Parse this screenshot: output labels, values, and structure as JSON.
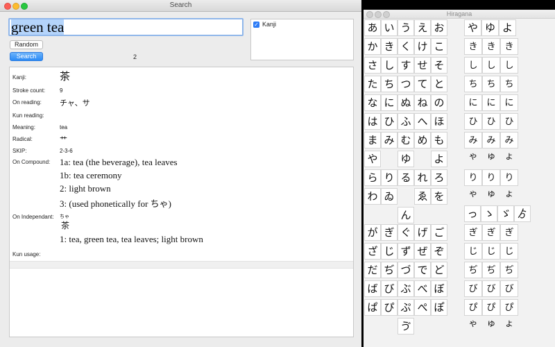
{
  "search_window": {
    "title": "Search",
    "query": "green tea",
    "random_label": "Random",
    "search_label": "Search",
    "result_count": "2",
    "kanji_filter_label": "Kanji",
    "kanji_filter_checked": true
  },
  "result": {
    "labels": {
      "kanji": "Kanji:",
      "stroke_count": "Stroke count:",
      "on_reading": "On reading:",
      "kun_reading": "Kun reading:",
      "meaning": "Meaning:",
      "radical": "Radical:",
      "skip": "SKIP:",
      "on_compound": "On Compound:",
      "on_independant": "On Independant:",
      "kun_usage": "Kun usage:"
    },
    "kanji": "茶",
    "stroke_count": "9",
    "on_reading": "チャ、サ",
    "kun_reading": "",
    "meaning": "tea",
    "radical": "艹",
    "skip": "2-3-6",
    "on_compound": [
      "1a: tea (the beverage), tea leaves",
      "1b: tea ceremony",
      "2: light brown",
      "3: (used phonetically for ちゃ)"
    ],
    "on_independant_ruby": "ちゃ",
    "on_independant_kanji": "茶",
    "on_independant_meaning": "1: tea, green tea, tea leaves; light brown"
  },
  "hiragana_window": {
    "title": "Hiragana",
    "basic_rows": [
      [
        "あ",
        "い",
        "う",
        "え",
        "お"
      ],
      [
        "か",
        "き",
        "く",
        "け",
        "こ"
      ],
      [
        "さ",
        "し",
        "す",
        "せ",
        "そ"
      ],
      [
        "た",
        "ち",
        "つ",
        "て",
        "と"
      ],
      [
        "な",
        "に",
        "ぬ",
        "ね",
        "の"
      ],
      [
        "は",
        "ひ",
        "ふ",
        "へ",
        "ほ"
      ],
      [
        "ま",
        "み",
        "む",
        "め",
        "も"
      ],
      [
        "や",
        "",
        "ゆ",
        "",
        "よ"
      ],
      [
        "ら",
        "り",
        "る",
        "れ",
        "ろ"
      ],
      [
        "わ",
        "ゐ",
        "",
        "ゑ",
        "を"
      ],
      [
        "",
        "",
        "ん",
        "",
        ""
      ]
    ],
    "combo_top": [
      [
        "や",
        "ゆ",
        "よ"
      ],
      [
        "きゃ",
        "きゅ",
        "きょ"
      ],
      [
        "しゃ",
        "しゅ",
        "しょ"
      ],
      [
        "ちゃ",
        "ちゅ",
        "ちょ"
      ],
      [
        "にゃ",
        "にゅ",
        "にょ"
      ],
      [
        "ひゃ",
        "ひゅ",
        "ひょ"
      ],
      [
        "みゃ",
        "みゅ",
        "みょ"
      ],
      [
        "",
        "",
        ""
      ],
      [
        "りゃ",
        "りゅ",
        "りょ"
      ]
    ],
    "marks": [
      "っ",
      "ゝ",
      "ゞ",
      "ゟ"
    ],
    "voiced_rows": [
      [
        "が",
        "ぎ",
        "ぐ",
        "げ",
        "ご"
      ],
      [
        "ざ",
        "じ",
        "ず",
        "ぜ",
        "ぞ"
      ],
      [
        "だ",
        "ぢ",
        "づ",
        "で",
        "ど"
      ],
      [
        "ば",
        "び",
        "ぶ",
        "べ",
        "ぼ"
      ],
      [
        "ぱ",
        "ぴ",
        "ぷ",
        "ぺ",
        "ぽ"
      ],
      [
        "",
        "",
        "ゔ",
        "",
        ""
      ]
    ],
    "voiced_combos": [
      [
        "ぎゃ",
        "ぎゅ",
        "ぎょ"
      ],
      [
        "じゃ",
        "じゅ",
        "じょ"
      ],
      [
        "ぢゃ",
        "ぢゅ",
        "ぢょ"
      ],
      [
        "びゃ",
        "びゅ",
        "びょ"
      ],
      [
        "ぴゃ",
        "ぴゅ",
        "ぴょ"
      ]
    ]
  }
}
